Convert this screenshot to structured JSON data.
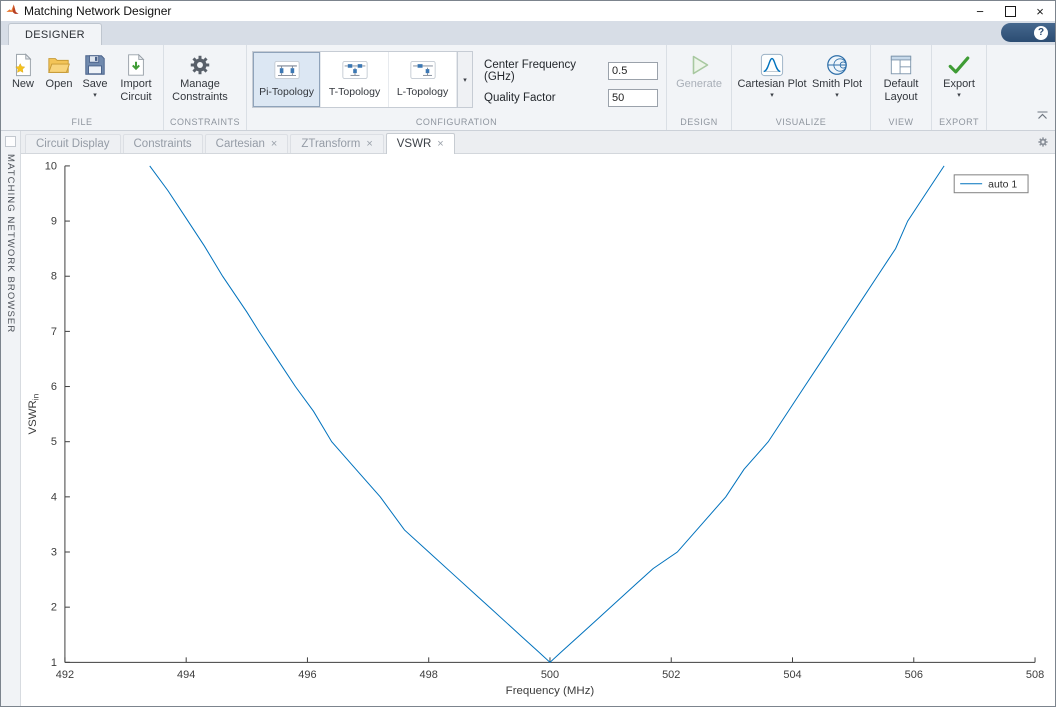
{
  "window": {
    "title": "Matching Network Designer"
  },
  "window_controls": {
    "minimize": "−",
    "close": "×"
  },
  "icons": {
    "caret_down": "▾",
    "close": "×",
    "help": "?"
  },
  "colors": {
    "accent_blue": "#0072BD",
    "selected_gallery_bg": "#dce7f3",
    "green_check": "#3f9c35"
  },
  "ribbon": {
    "tab": "DESIGNER",
    "groups": {
      "file": {
        "label": "FILE",
        "new": "New",
        "open": "Open",
        "save": "Save",
        "import_circuit": "Import Circuit"
      },
      "constraints": {
        "label": "CONSTRAINTS",
        "manage": "Manage Constraints"
      },
      "configuration": {
        "label": "CONFIGURATION",
        "pi": "Pi-Topology",
        "t": "T-Topology",
        "l": "L-Topology",
        "center_frequency_label": "Center Frequency (GHz)",
        "center_frequency_value": "0.5",
        "quality_factor_label": "Quality Factor",
        "quality_factor_value": "50"
      },
      "design": {
        "label": "DESIGN",
        "generate": "Generate"
      },
      "visualize": {
        "label": "VISUALIZE",
        "cartesian": "Cartesian Plot",
        "smith": "Smith Plot"
      },
      "view": {
        "label": "VIEW",
        "default_layout": "Default Layout"
      },
      "export": {
        "label": "EXPORT",
        "export": "Export"
      }
    }
  },
  "browser_panel": {
    "title": "MATCHING NETWORK BROWSER"
  },
  "doc_tabs": [
    {
      "label": "Circuit Display",
      "closable": false,
      "active": false
    },
    {
      "label": "Constraints",
      "closable": false,
      "active": false
    },
    {
      "label": "Cartesian",
      "closable": true,
      "active": false
    },
    {
      "label": "ZTransform",
      "closable": true,
      "active": false
    },
    {
      "label": "VSWR",
      "closable": true,
      "active": true
    }
  ],
  "chart_data": {
    "type": "line",
    "title": "",
    "xlabel": "Frequency (MHz)",
    "ylabel": "VSWRin",
    "ylabel_base": "VSWR",
    "ylabel_sub": "in",
    "xlim": [
      492,
      508
    ],
    "ylim": [
      1,
      10
    ],
    "xticks": [
      492,
      494,
      496,
      498,
      500,
      502,
      504,
      506,
      508
    ],
    "yticks": [
      1,
      2,
      3,
      4,
      5,
      6,
      7,
      8,
      9,
      10
    ],
    "grid": false,
    "legend": {
      "position": "top-right",
      "entries": [
        "auto 1"
      ]
    },
    "series": [
      {
        "name": "auto 1",
        "color": "#0072BD",
        "points": [
          [
            493.4,
            10.0
          ],
          [
            493.7,
            9.55
          ],
          [
            494.0,
            9.05
          ],
          [
            494.3,
            8.55
          ],
          [
            494.6,
            8.0
          ],
          [
            495.0,
            7.35
          ],
          [
            495.2,
            7.0
          ],
          [
            495.5,
            6.5
          ],
          [
            495.8,
            6.0
          ],
          [
            496.1,
            5.55
          ],
          [
            496.4,
            5.0
          ],
          [
            496.8,
            4.5
          ],
          [
            497.2,
            4.0
          ],
          [
            497.6,
            3.4
          ],
          [
            498.0,
            3.0
          ],
          [
            498.4,
            2.6
          ],
          [
            498.8,
            2.2
          ],
          [
            499.0,
            2.0
          ],
          [
            499.3,
            1.7
          ],
          [
            499.6,
            1.4
          ],
          [
            499.8,
            1.2
          ],
          [
            500.0,
            1.0
          ],
          [
            500.2,
            1.2
          ],
          [
            500.5,
            1.5
          ],
          [
            500.8,
            1.8
          ],
          [
            501.0,
            2.0
          ],
          [
            501.4,
            2.4
          ],
          [
            501.7,
            2.7
          ],
          [
            502.1,
            3.0
          ],
          [
            502.5,
            3.5
          ],
          [
            502.9,
            4.0
          ],
          [
            503.2,
            4.5
          ],
          [
            503.6,
            5.0
          ],
          [
            503.9,
            5.5
          ],
          [
            504.2,
            6.0
          ],
          [
            504.5,
            6.5
          ],
          [
            504.8,
            7.0
          ],
          [
            505.1,
            7.5
          ],
          [
            505.4,
            8.0
          ],
          [
            505.7,
            8.5
          ],
          [
            505.9,
            9.0
          ],
          [
            506.2,
            9.5
          ],
          [
            506.5,
            10.0
          ]
        ]
      }
    ]
  }
}
